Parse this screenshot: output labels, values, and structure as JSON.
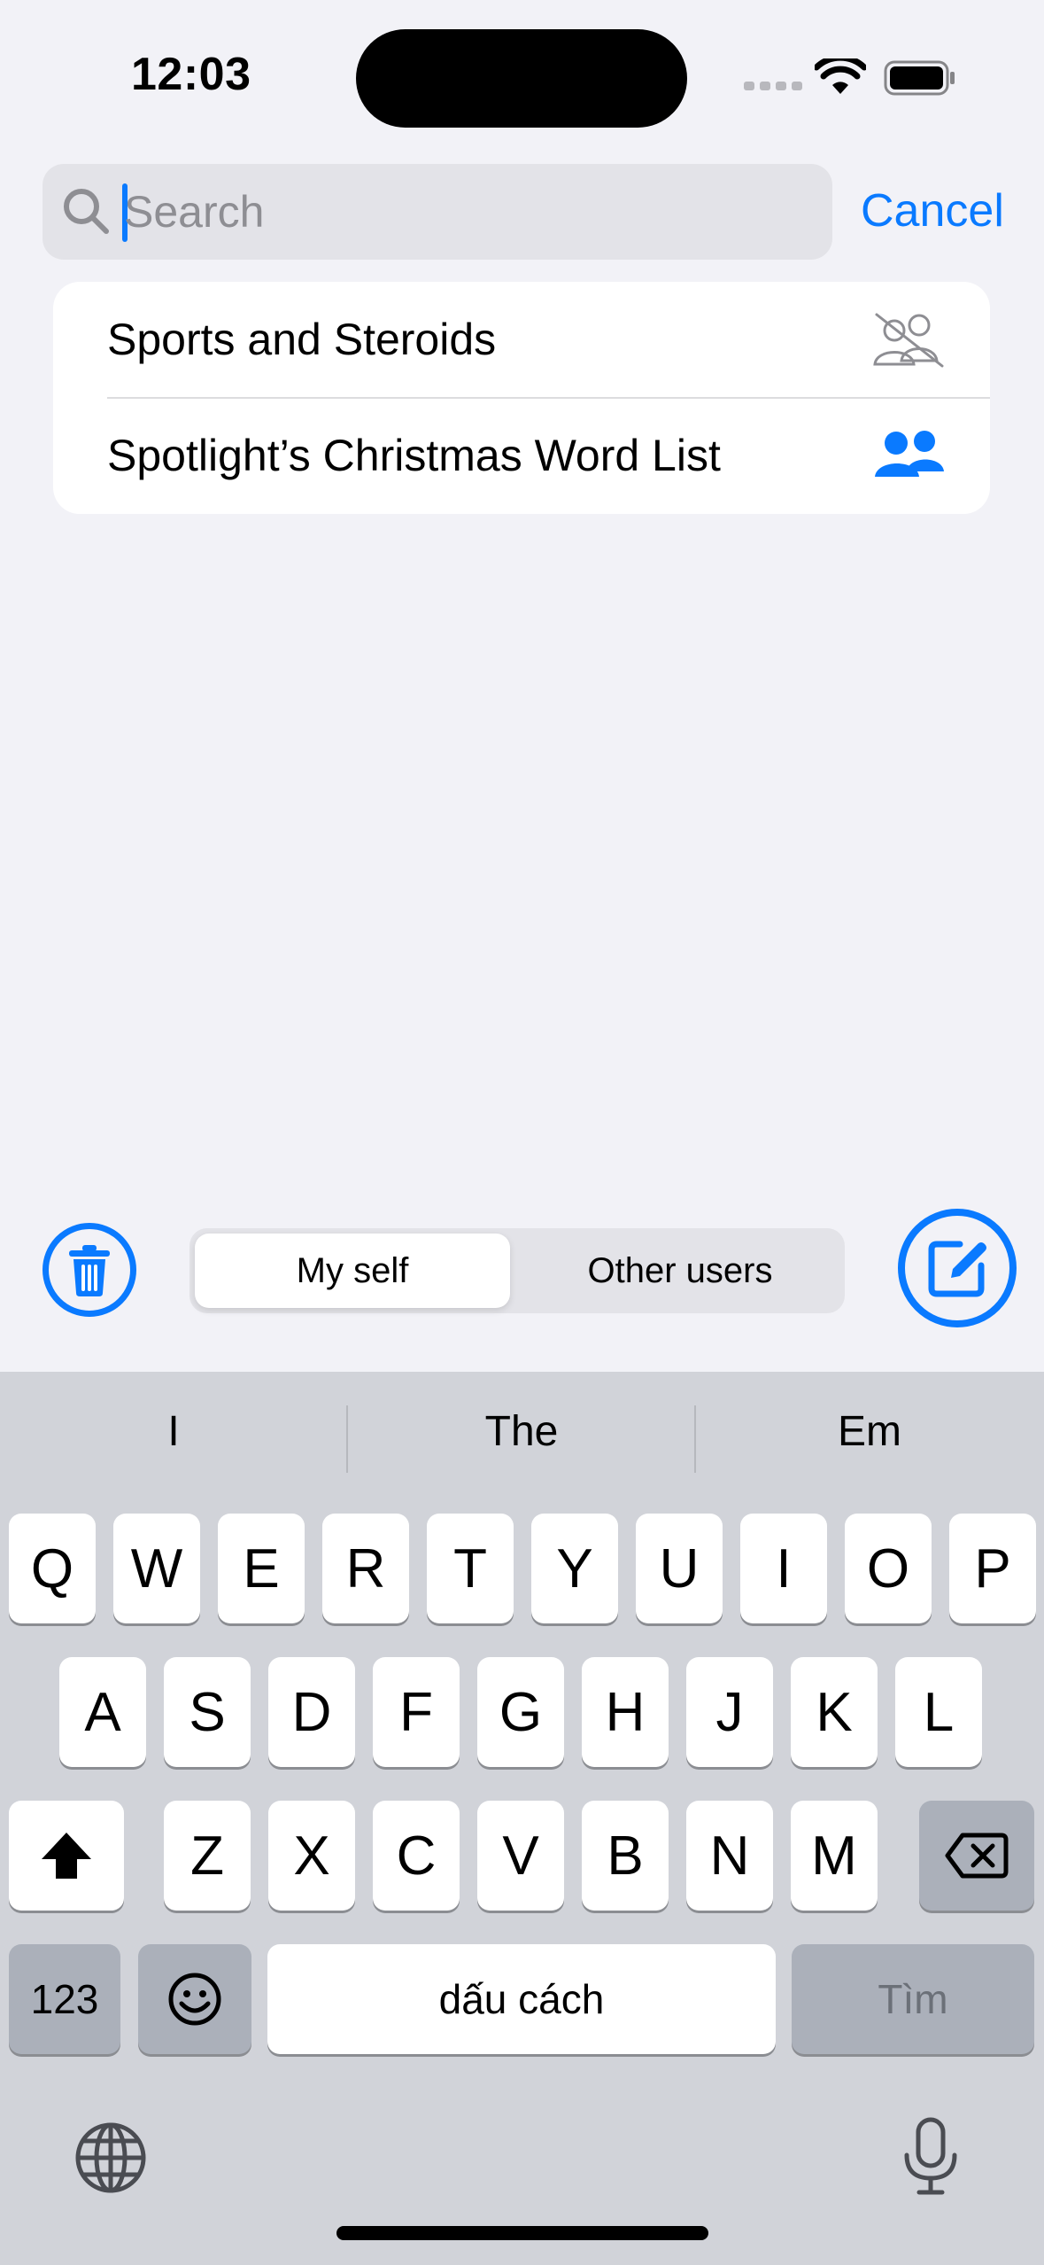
{
  "status": {
    "time": "12:03"
  },
  "search": {
    "placeholder": "Search",
    "value": "",
    "cancel_label": "Cancel"
  },
  "list": {
    "items": [
      {
        "label": "Sports and Steroids",
        "icon": "person-2-slash-icon"
      },
      {
        "label": "Spotlight’s Christmas Word List",
        "icon": "person-2-fill-icon"
      }
    ]
  },
  "toolbar": {
    "segments": [
      "My self",
      "Other users"
    ],
    "selected": "My self"
  },
  "keyboard": {
    "suggestions": [
      "I",
      "The",
      "Em"
    ],
    "row1": [
      "Q",
      "W",
      "E",
      "R",
      "T",
      "Y",
      "U",
      "I",
      "O",
      "P"
    ],
    "row2": [
      "A",
      "S",
      "D",
      "F",
      "G",
      "H",
      "J",
      "K",
      "L"
    ],
    "row3": [
      "Z",
      "X",
      "C",
      "V",
      "B",
      "N",
      "M"
    ],
    "numbers_label": "123",
    "space_label": "dấu cách",
    "search_label": "Tìm"
  },
  "colors": {
    "accent": "#0a7aff",
    "background": "#f2f2f7",
    "keyboard": "#d1d3d9"
  }
}
